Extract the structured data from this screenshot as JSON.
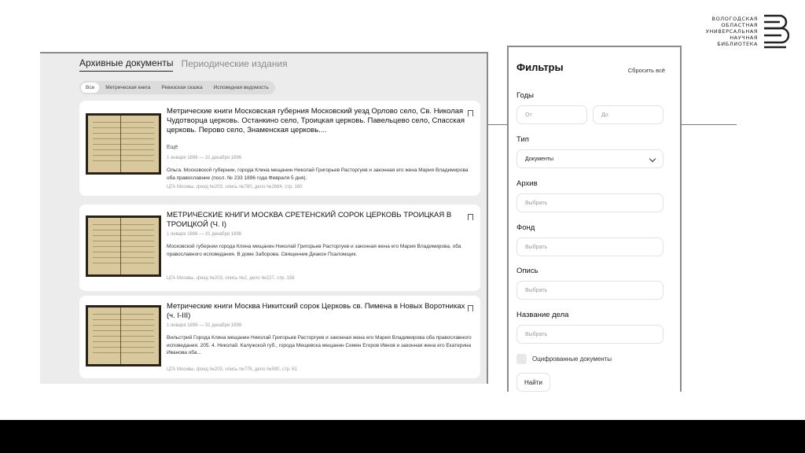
{
  "logo": {
    "lines": [
      "ВОЛОГОДСКАЯ",
      "ОБЛАСТНАЯ",
      "УНИВЕРСАЛЬНАЯ",
      "НАУЧНАЯ",
      "БИБЛИОТЕКА"
    ],
    "icon": "library-lines-logo"
  },
  "tabs": [
    {
      "label": "Архивные документы",
      "active": true
    },
    {
      "label": "Периодические издания",
      "active": false
    }
  ],
  "chips": [
    "Все",
    "Метрическая книга",
    "Ревизская сказка",
    "Исповедная ведомость"
  ],
  "results": [
    {
      "title": "Метрические книги Московская губерния Московский уезд Орлово село, Св. Николая Чудотворца церковь. Останкино село, Троицкая церковь. Павельцево село, Спасская церковь. Перово село, Знаменская церковь....",
      "more": "Ещё",
      "date": "1 января 1896 — 31 декабря 1896",
      "desc": "Ольга. Московской губернии, города Клина мещанин Николай Григорьев Расторгуев и законная его жена Мария Владимирова оба православние (посл. № 233 1896 года Февраля 5 дня).",
      "source": "ЦГА Москвы, фонд №203, опись №780, дело №2684, стр. 160"
    },
    {
      "title": "МЕТРИЧЕСКИЕ КНИГИ МОСКВА СРЕТЕНСКИЙ СОРОК ЦЕРКОВЬ ТРОИЦКАЯ В ТРОИЦКОЙ (Ч. I)",
      "date": "1 января 1896 — 31 декабря 1896",
      "desc": "Московской губернии города Клина мещанин Николай Григорьев Расторгуев и законная жена его Мария Владимирова, оба православного исповедания. В доме Заборова. Священник Диакон Псаломщик.",
      "source": "ЦГА Москвы, фонд №203, опись №2, дело №227, стр. 158"
    },
    {
      "title": "Метрические книги Москва Никитский сорок Церковь св. Пимена в Новых Воротниках (ч. I-III)",
      "date": "1 января 1898 — 31 декабря 1898",
      "desc": "Вильстрий Города Клина мещанин Николай Григорьев Расторгуев и законная жена его Мария Владимирова оба православного исповедания. 205. 4. Николай. Калужской губ., города Мещевска мещанин Семен Егоров Ивнов и законная жена его Екатерина Иванова оба...",
      "source": "ЦГА Москвы, фонд №203, опись №776, дело №590, стр. 61"
    }
  ],
  "filters": {
    "title": "Фильтры",
    "reset": "Сбросить всё",
    "years_label": "Годы",
    "from_placeholder": "От",
    "to_placeholder": "До",
    "type_label": "Тип",
    "type_value": "Документы",
    "archive_label": "Архив",
    "archive_placeholder": "Выбрать",
    "fond_label": "Фонд",
    "fond_placeholder": "Выбрать",
    "opis_label": "Опись",
    "opis_placeholder": "Выбрать",
    "case_label": "Название дела",
    "case_placeholder": "Выбрать",
    "digitized_label": "Оцифрованные документы",
    "find_button": "Найти"
  }
}
